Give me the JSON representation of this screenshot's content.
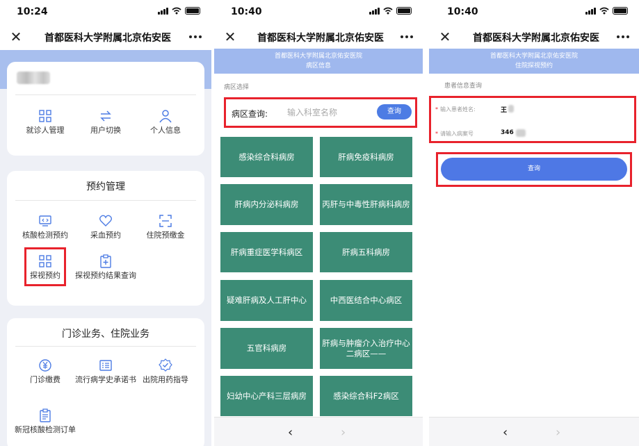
{
  "panel1": {
    "time": "10:24",
    "nav_title": "首都医科大学附属北京佑安医",
    "user_menu": [
      {
        "label": "就诊人管理",
        "icon": "grid-icon"
      },
      {
        "label": "用户切换",
        "icon": "switch-arrows-icon"
      },
      {
        "label": "个人信息",
        "icon": "person-icon"
      }
    ],
    "booking": {
      "title": "预约管理",
      "items": [
        {
          "label": "核酸检测预约",
          "icon": "monitor-code-icon"
        },
        {
          "label": "采血预约",
          "icon": "heart-icon"
        },
        {
          "label": "住院预缴金",
          "icon": "scan-frame-icon"
        },
        {
          "label": "探视预约",
          "icon": "grid-icon"
        },
        {
          "label": "探视预约结果查询",
          "icon": "clipboard-plus-icon"
        }
      ]
    },
    "outpatient": {
      "title": "门诊业务、住院业务",
      "items": [
        {
          "label": "门诊缴费",
          "icon": "yen-circle-icon"
        },
        {
          "label": "流行病学史承诺书",
          "icon": "document-list-icon"
        },
        {
          "label": "出院用药指导",
          "icon": "badge-check-icon"
        },
        {
          "label": "新冠核酸检测订单",
          "icon": "clipboard-list-icon"
        }
      ]
    }
  },
  "panel2": {
    "time": "10:40",
    "nav_title": "首都医科大学附属北京佑安医",
    "banner_line1": "首都医科大学附属北京佑安医院",
    "banner_line2": "病区信息",
    "section_label": "病区选择",
    "search_label": "病区查询:",
    "search_placeholder": "输入科室名称",
    "search_button": "查询",
    "wards": [
      "感染综合科病房",
      "肝病免疫科病房",
      "肝病内分泌科病房",
      "丙肝与中毒性肝病科病房",
      "肝病重症医学科病区",
      "肝病五科病房",
      "疑难肝病及人工肝中心",
      "中西医结合中心病区",
      "五官科病房",
      "肝病与肿瘤介入治疗中心二病区——",
      "妇幼中心产科三层病房",
      "感染综合科F2病区"
    ],
    "back": "‹",
    "forward": "›"
  },
  "panel3": {
    "time": "10:40",
    "nav_title": "首都医科大学附属北京佑安医",
    "banner_line1": "首都医科大学附属北京佑安医院",
    "banner_line2": "住院探视预约",
    "section_label": "患者信息查询",
    "name_label": "输入患者姓名:",
    "name_value": "王",
    "record_label": "请输入病案号",
    "record_value": "346",
    "query_button": "查询",
    "back": "‹",
    "forward": "›"
  },
  "colors": {
    "ward_tile": "#3c8c76",
    "primary_button": "#4d7ce4",
    "banner": "#9fb8ee",
    "highlight": "#e8222c",
    "icon": "#4d7ce4"
  }
}
